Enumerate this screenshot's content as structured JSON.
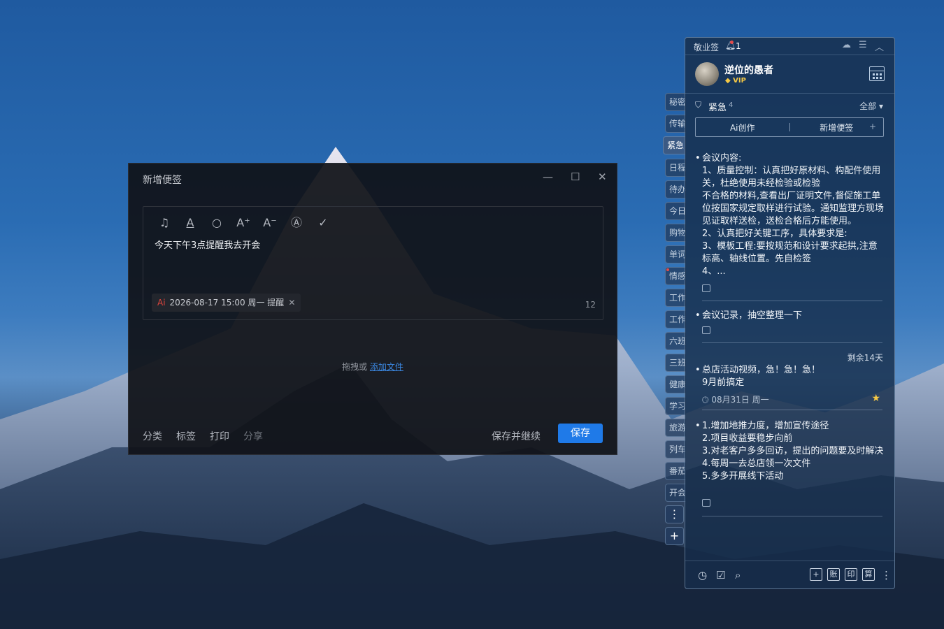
{
  "desktop": {
    "wallpaper": "snowy-mountain"
  },
  "sticky_app": {
    "app_name": "敬业签",
    "notification_count": "1",
    "user": {
      "name": "逆位的愚者",
      "badge": "VIP"
    },
    "category": {
      "name": "紧急",
      "count": "4",
      "filter": "全部"
    },
    "actions": {
      "ai_create": "Ai创作",
      "new_note": "新增便签"
    },
    "side_tabs": [
      "秘密",
      "传输",
      "紧急",
      "日程",
      "待办",
      "今日",
      "购物",
      "单词",
      "情感",
      "工作",
      "工作",
      "六班",
      "三班",
      "健康",
      "学习",
      "旅游",
      "列车",
      "番茄",
      "开会"
    ],
    "notes": [
      {
        "text": "会议内容:\n1、质量控制：认真把好原材料、构配件使用关，杜绝使用未经检验或检验\n不合格的材料,查看出厂证明文件,督促施工单位按国家规定取样进行试验。通知监理方现场见证取样送检，送检合格后方能使用。\n2、认真把好关键工序，具体要求是:\n3、模板工程:要按规范和设计要求起拱,注意标高、轴线位置。先自检签\n4、..."
      },
      {
        "text": "会议记录，抽空整理一下"
      },
      {
        "remaining": "剩余14天",
        "text": "总店活动视频，急！急！急！\n9月前搞定",
        "date": "08月31日 周一"
      },
      {
        "text": "1.增加地推力度，增加宣传途径\n2.项目收益要稳步向前\n3.对老客户多多回访，提出的问题要及时解决\n4.每周一去总店领一次文件\n5.多多开展线下活动"
      }
    ],
    "bottom_boxes": [
      "+",
      "账",
      "印",
      "算"
    ]
  },
  "dialog": {
    "title": "新增便签",
    "content": "今天下午3点提醒我去开会",
    "reminder": {
      "ai_label": "Ai",
      "text": "2026-08-17 15:00 周一 提醒"
    },
    "char_count": "12",
    "drop_text": "拖拽或",
    "drop_link": "添加文件",
    "footer": {
      "category": "分类",
      "tag": "标签",
      "print": "打印",
      "share": "分享",
      "save_continue": "保存并继续",
      "save": "保存"
    }
  }
}
